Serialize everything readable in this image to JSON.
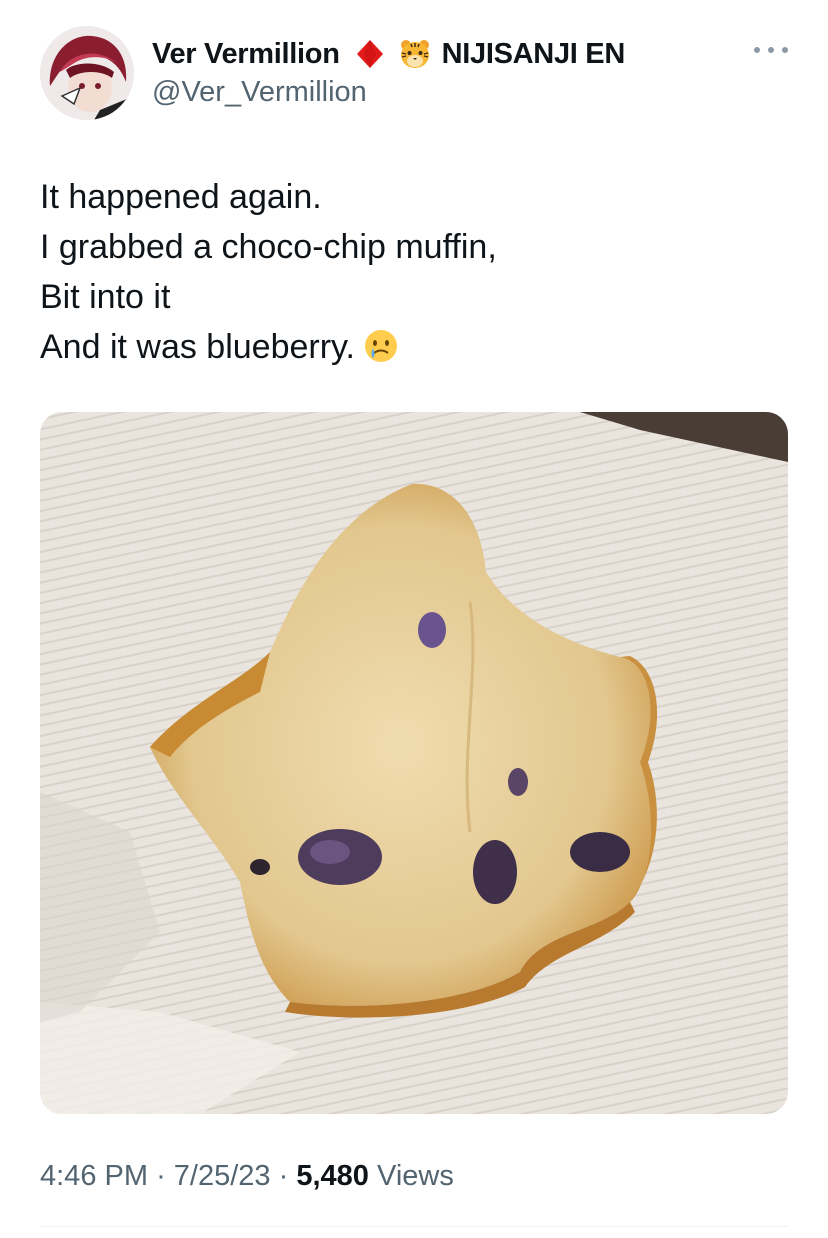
{
  "tweet": {
    "author": {
      "display_name": "Ver Vermillion",
      "handle": "@Ver_Vermillion",
      "affiliation": "NIJISANJI EN",
      "badge_icon": "red-diamond-icon",
      "affiliation_icon": "tiger-face-icon"
    },
    "text_lines": [
      "It happened again.",
      "I grabbed a choco-chip muffin,",
      "Bit into it",
      "And it was blueberry."
    ],
    "trailing_emoji": "crying-face-emoji",
    "media": {
      "description_icon": "muffin-photo"
    },
    "meta": {
      "time": "4:46 PM",
      "sep1": "·",
      "date": "7/25/23",
      "sep2": "·",
      "views_count": "5,480",
      "views_label": "Views"
    }
  },
  "colors": {
    "text": "#0f1419",
    "secondary": "#536471",
    "diamond": "#e11a1a"
  }
}
